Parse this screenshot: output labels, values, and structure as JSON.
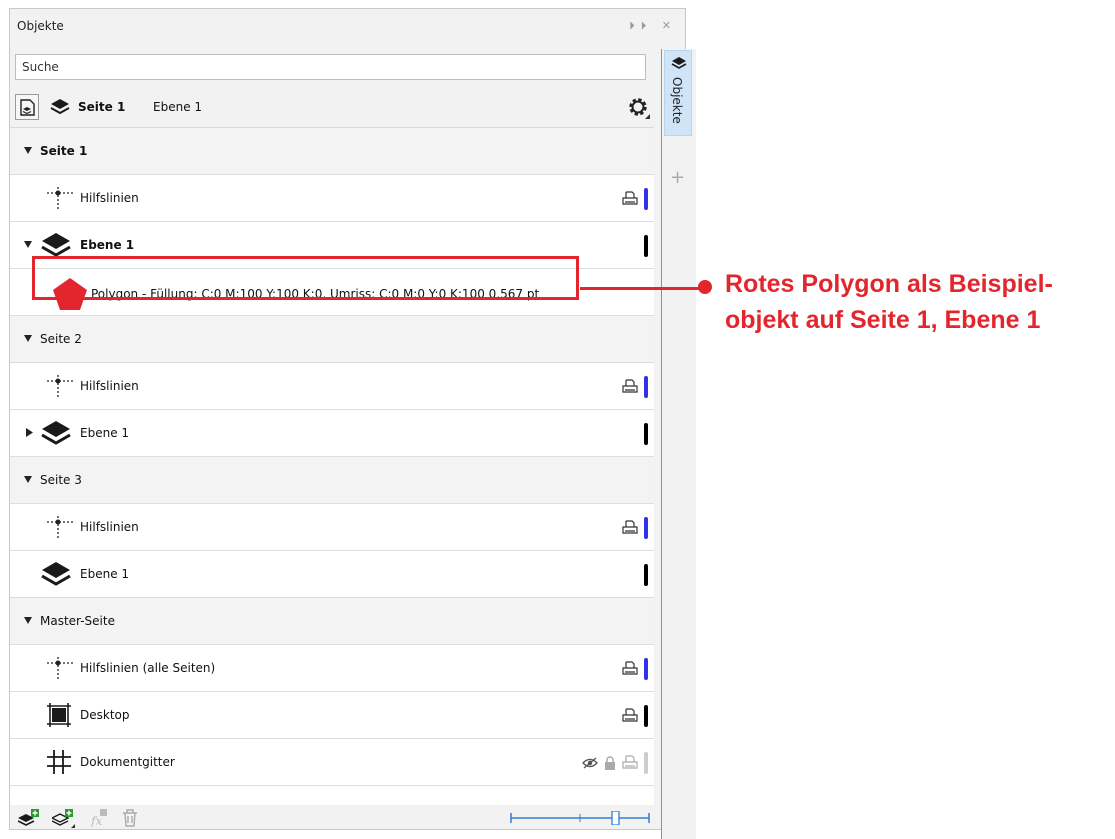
{
  "panel": {
    "title": "Objekte",
    "window_controls": "⏵⏵ ✕"
  },
  "search": {
    "placeholder": "Suche"
  },
  "toolbar": {
    "current_page": "Seite 1",
    "current_layer": "Ebene 1"
  },
  "tree": {
    "rows": [
      {
        "kind": "page",
        "label": "Seite 1",
        "bold": true
      },
      {
        "kind": "guides",
        "label": "Hilfslinien",
        "color": "#3232e6"
      },
      {
        "kind": "layer",
        "label": "Ebene 1",
        "bold": true,
        "expanded": true,
        "color": "#000000"
      },
      {
        "kind": "object",
        "label": "Polygon - Füllung: C:0 M:100 Y:100 K:0, Umriss: C:0 M:0 Y:0 K:100  0,567 pt"
      },
      {
        "kind": "page",
        "label": "Seite 2"
      },
      {
        "kind": "guides",
        "label": "Hilfslinien",
        "color": "#3232e6"
      },
      {
        "kind": "layer",
        "label": "Ebene 1",
        "expanded": false,
        "color": "#000000"
      },
      {
        "kind": "page",
        "label": "Seite 3"
      },
      {
        "kind": "guides",
        "label": "Hilfslinien",
        "color": "#3232e6"
      },
      {
        "kind": "layer",
        "label": "Ebene 1",
        "color": "#000000"
      },
      {
        "kind": "page",
        "label": "Master-Seite"
      },
      {
        "kind": "guides",
        "label": "Hilfslinien (alle Seiten)",
        "color": "#3232e6"
      },
      {
        "kind": "desktop",
        "label": "Desktop",
        "color": "#000000"
      },
      {
        "kind": "grid",
        "label": "Dokumentgitter",
        "color": "#cccccc"
      }
    ]
  },
  "side_tab": {
    "label": "Objekte"
  },
  "annotation": {
    "line1": "Rotes Polygon als Beispiel-",
    "line2": "objekt auf Seite 1, Ebene 1"
  },
  "colors": {
    "accent_red": "#e3262d",
    "polygon_fill": "#e3262d",
    "guide_bar": "#3232e6",
    "side_border": "#4aa3e6"
  }
}
